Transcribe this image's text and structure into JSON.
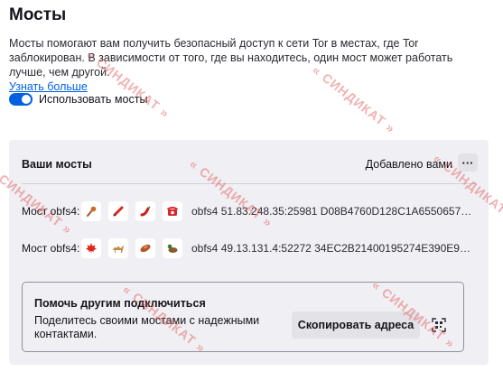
{
  "page": {
    "title": "Мосты",
    "description": "Мосты помогают вам получить безопасный доступ к сети Tor в местах, где Tor заблокирован. В зависимости от того, где вы находитесь, один мост может работать лучше, чем другой.",
    "learn_more": "Узнать больше"
  },
  "toggle": {
    "label": "Использовать мосты",
    "on": true
  },
  "bridges_card": {
    "heading": "Ваши мосты",
    "added_by": "Добавлено вами",
    "more_icon": "ellipsis-icon",
    "items": [
      {
        "label": "Мост obfs4:",
        "emojis": [
          "microphone-icon",
          "pen-icon",
          "chili-pepper-icon",
          "telephone-icon"
        ],
        "line": "obfs4 51.83.248.35:25981 D08B4760D128C1A65506577E0..."
      },
      {
        "label": "Мост obfs4:",
        "emojis": [
          "maple-leaf-icon",
          "camel-icon",
          "sweet-potato-icon",
          "duck-icon"
        ],
        "line": "obfs4 49.13.131.4:52272 34EC2B21400195274E390E9EA56..."
      }
    ]
  },
  "help_box": {
    "title": "Помочь другим подключиться",
    "description": "Поделитесь своими мостами с надежными контактами.",
    "copy_button": "Скопировать адреса",
    "qr_icon": "qr-code-icon"
  },
  "watermark": "« СИНДИКАТ »",
  "colors": {
    "accent": "#0061e0",
    "card_bg": "#f0f0f4",
    "watermark": "#e25252"
  }
}
